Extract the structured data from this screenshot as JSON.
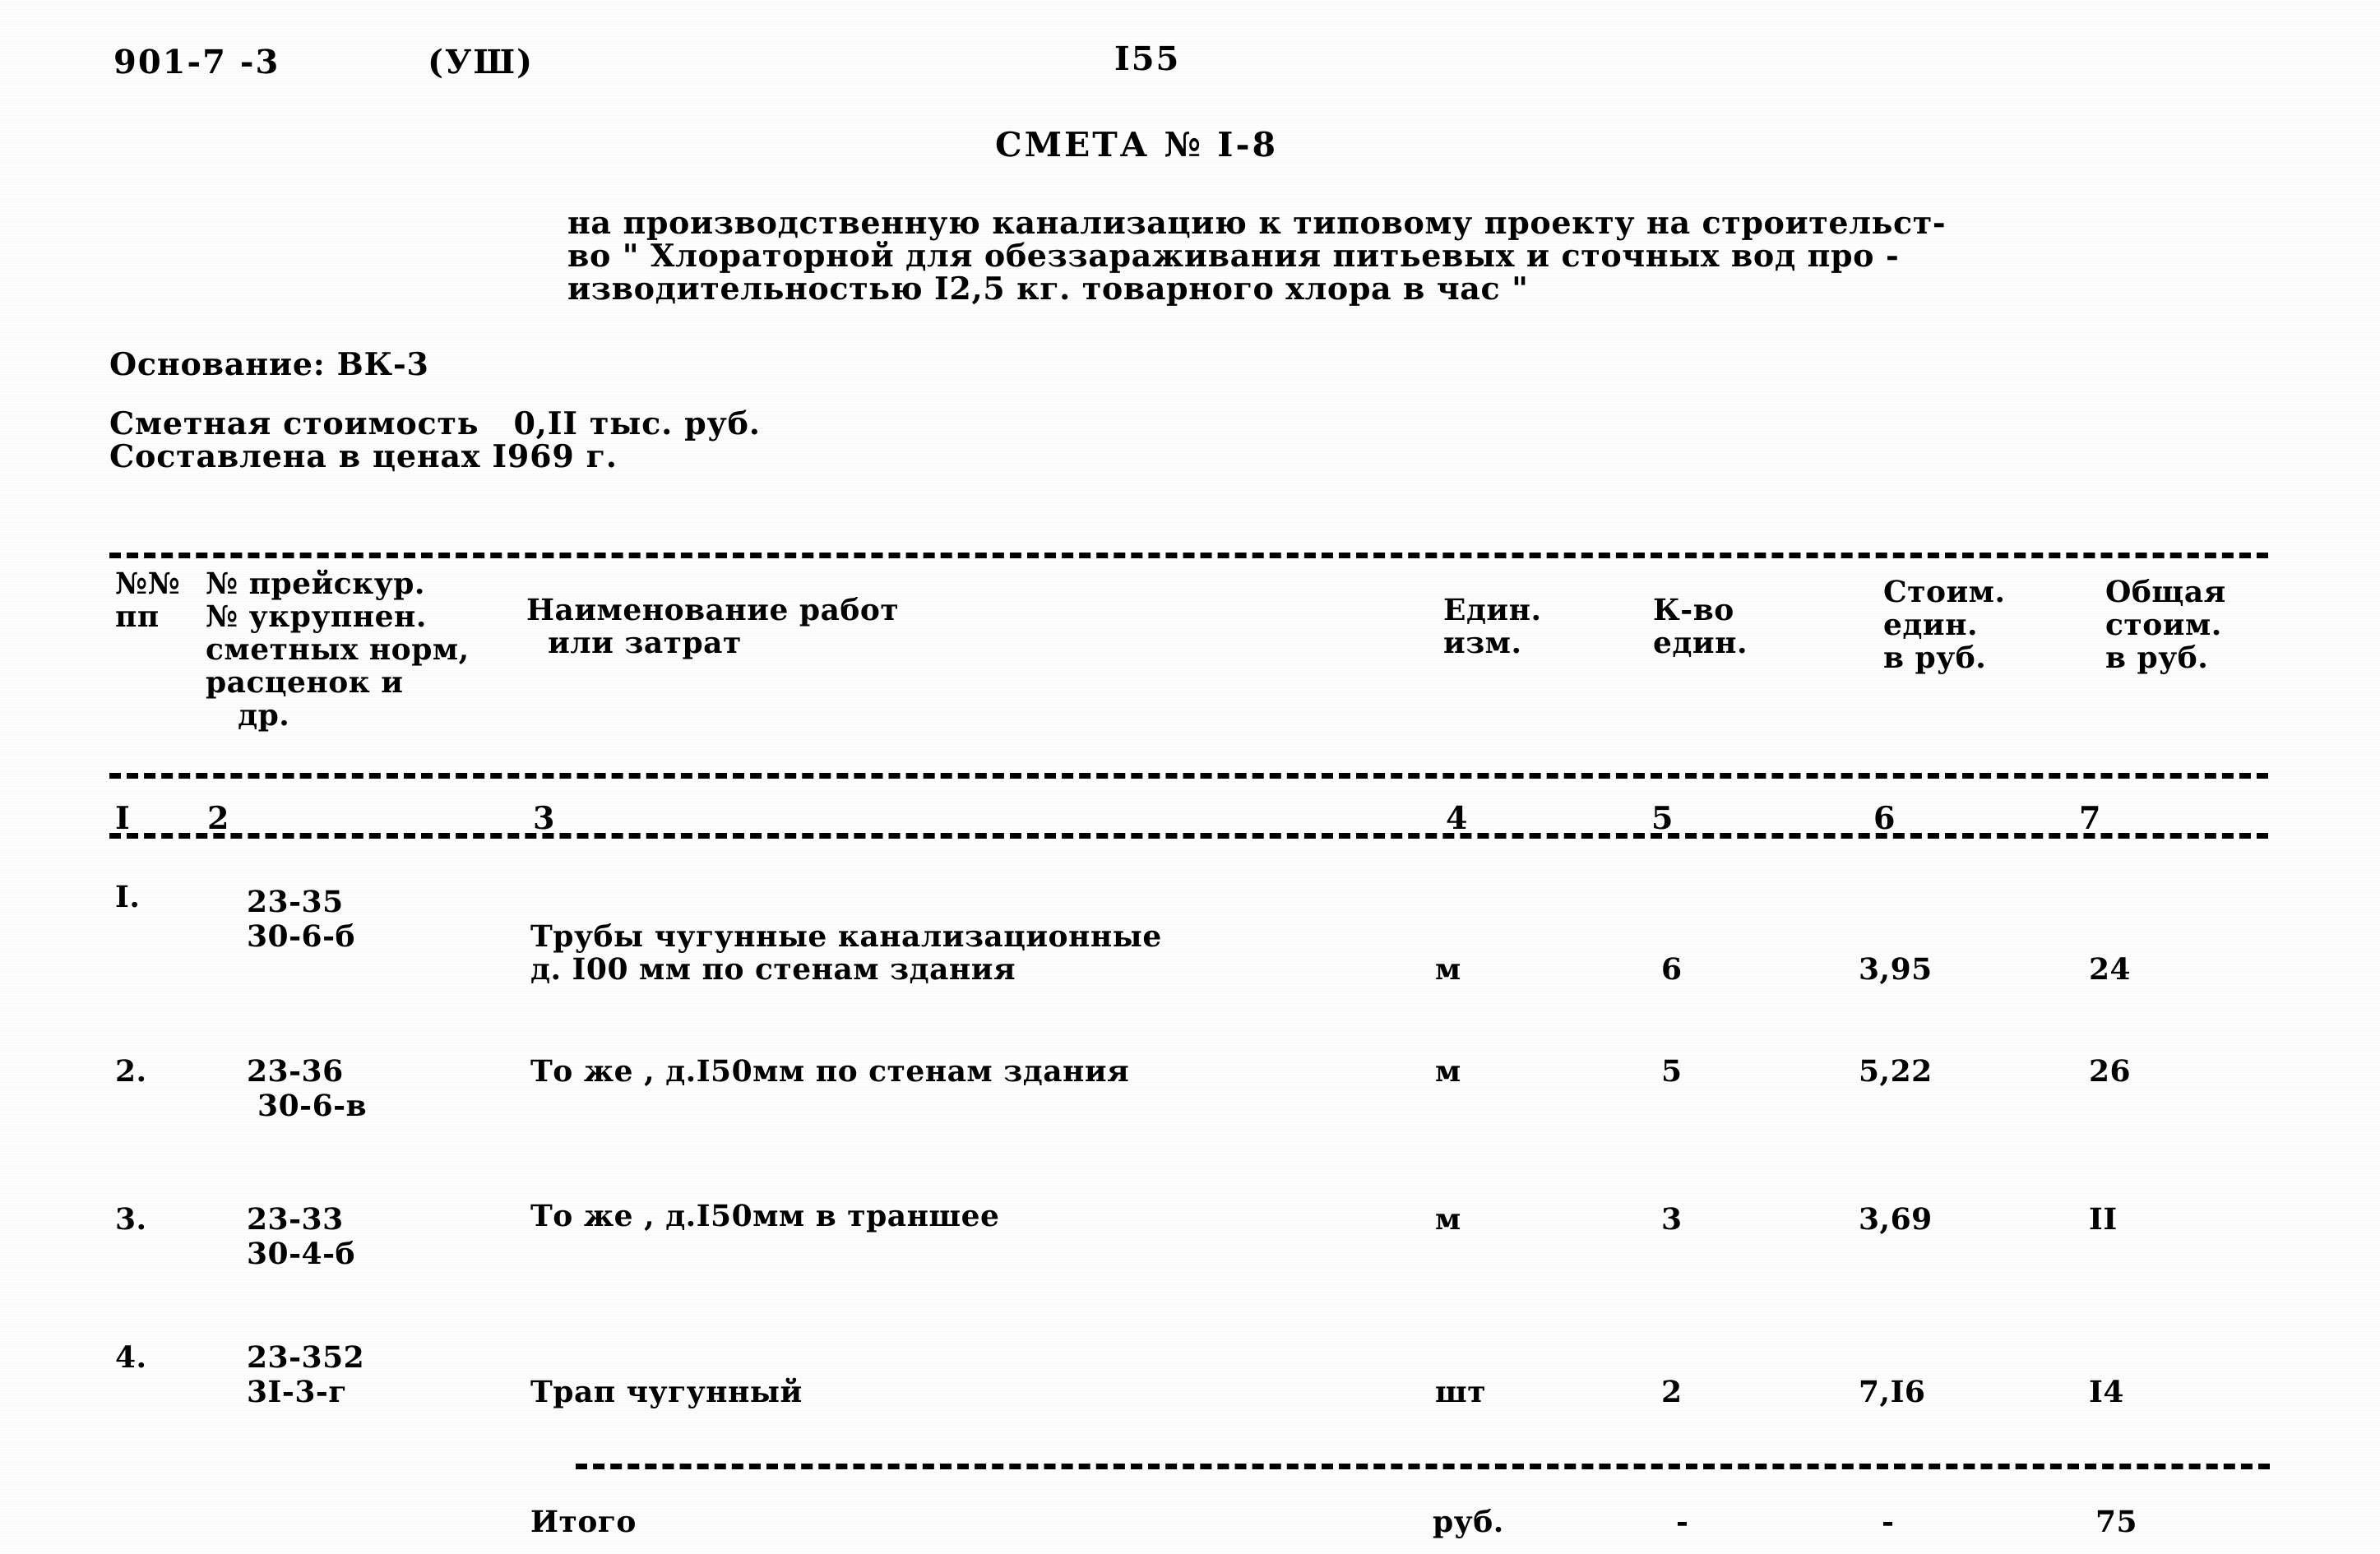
{
  "header": {
    "doc_code": "901-7 -3",
    "volume": "(УШ)",
    "page_number": "I55"
  },
  "title": "СМЕТА № I-8",
  "subtitle": {
    "line1": "на производственную канализацию к типовому проекту на строительст-",
    "line2": "во \" Хлораторной для обеззараживания питьевых и сточных вод про -",
    "line3": "изводительностью I2,5 кг. товарного хлора в час \""
  },
  "basis": {
    "osnovanie": "Основание: ВК-3",
    "cost": "Сметная стоимость   0,II тыс. руб.",
    "prices": "Составлена в ценах I969 г."
  },
  "table": {
    "headers": {
      "no": "№№\nпп",
      "code": "№ прейскур.\n№ укрупнен.\nсметных норм,\nрасценок и\n   др.",
      "name": "Наименование работ\n  или затрат",
      "unit": "Един.\nизм.",
      "qty": "К-во\nедин.",
      "price": "Стоим.\nедин.\nв руб.",
      "total": "Общая\nстоим.\nв руб."
    },
    "column_numbers": {
      "c1": "I",
      "c2": "2",
      "c3": "3",
      "c4": "4",
      "c5": "5",
      "c6": "6",
      "c7": "7"
    },
    "rows": [
      {
        "no": "I.",
        "code": "23-35\n30-6-б",
        "name_line1": "Трубы чугунные канализационные",
        "name_line2": "д. I00 мм по стенам здания",
        "unit": "м",
        "qty": "6",
        "price": "3,95",
        "total": "24"
      },
      {
        "no": "2.",
        "code": "23-36\n 30-6-в",
        "name_line1": "То же , д.I50мм по стенам здания",
        "name_line2": "",
        "unit": "м",
        "qty": "5",
        "price": "5,22",
        "total": "26"
      },
      {
        "no": "3.",
        "code": "23-33\n30-4-б",
        "name_line1": "То же , д.I50мм в траншее",
        "name_line2": "",
        "unit": "м",
        "qty": "3",
        "price": "3,69",
        "total": "II"
      },
      {
        "no": "4.",
        "code": "23-352\n3I-3-г",
        "name_line1": "Трап чугунный",
        "name_line2": "",
        "unit": "шт",
        "qty": "2",
        "price": "7,I6",
        "total": "I4"
      }
    ],
    "total_row": {
      "label": "Итого",
      "unit": "руб.",
      "qty": "-",
      "price": "-",
      "total": "75"
    }
  }
}
